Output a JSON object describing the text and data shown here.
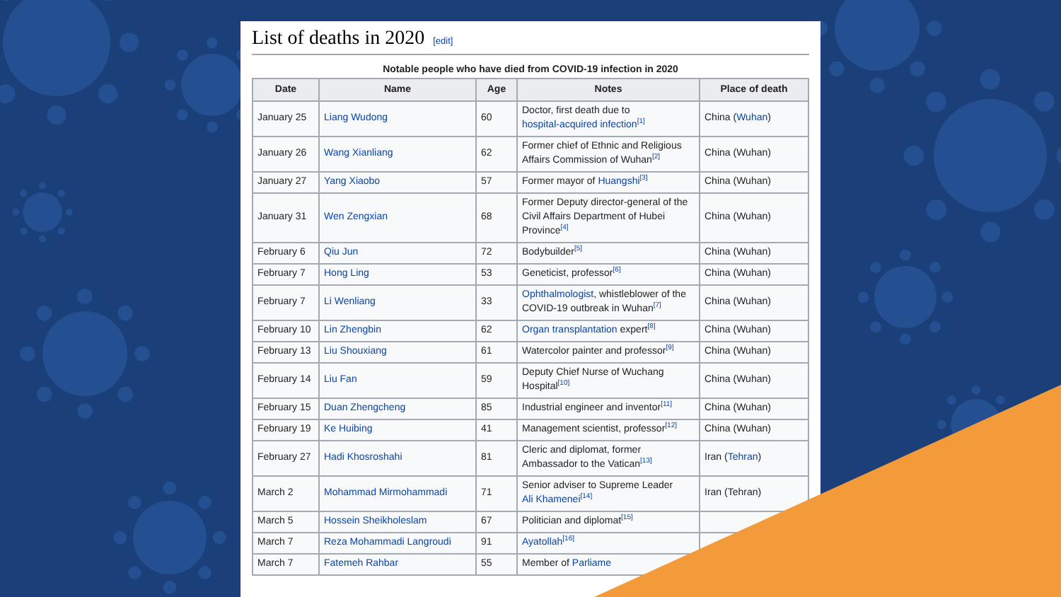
{
  "section": {
    "title": "List of deaths in 2020",
    "edit_link": "[edit]"
  },
  "table": {
    "caption": "Notable people who have died from COVID-19 infection in 2020",
    "columns": [
      "Date",
      "Name",
      "Age",
      "Notes",
      "Place of death"
    ],
    "rows": [
      {
        "date": "January 25",
        "name": "Liang Wudong",
        "age": "60",
        "notes": [
          {
            "kind": "text",
            "text": "Doctor, first death due to "
          },
          {
            "kind": "link",
            "text": "hospital-acquired infection"
          },
          {
            "kind": "ref",
            "text": "[1]"
          }
        ],
        "place": [
          {
            "kind": "text",
            "text": "China ("
          },
          {
            "kind": "link",
            "text": "Wuhan"
          },
          {
            "kind": "text",
            "text": ")"
          }
        ]
      },
      {
        "date": "January 26",
        "name": "Wang Xianliang",
        "age": "62",
        "notes": [
          {
            "kind": "text",
            "text": "Former chief of Ethnic and Religious Affairs Commission of Wuhan"
          },
          {
            "kind": "ref",
            "text": "[2]"
          }
        ],
        "place": [
          {
            "kind": "text",
            "text": "China (Wuhan)"
          }
        ]
      },
      {
        "date": "January 27",
        "name": "Yang Xiaobo",
        "age": "57",
        "notes": [
          {
            "kind": "text",
            "text": "Former mayor of "
          },
          {
            "kind": "link",
            "text": "Huangshi"
          },
          {
            "kind": "ref",
            "text": "[3]"
          }
        ],
        "place": [
          {
            "kind": "text",
            "text": "China (Wuhan)"
          }
        ]
      },
      {
        "date": "January 31",
        "name": "Wen Zengxian",
        "age": "68",
        "notes": [
          {
            "kind": "text",
            "text": "Former Deputy director-general of the Civil Affairs Department of Hubei Province"
          },
          {
            "kind": "ref",
            "text": "[4]"
          }
        ],
        "place": [
          {
            "kind": "text",
            "text": "China (Wuhan)"
          }
        ]
      },
      {
        "date": "February 6",
        "name": "Qiu Jun",
        "age": "72",
        "notes": [
          {
            "kind": "text",
            "text": "Bodybuilder"
          },
          {
            "kind": "ref",
            "text": "[5]"
          }
        ],
        "place": [
          {
            "kind": "text",
            "text": "China (Wuhan)"
          }
        ]
      },
      {
        "date": "February 7",
        "name": "Hong Ling",
        "age": "53",
        "notes": [
          {
            "kind": "text",
            "text": "Geneticist, professor"
          },
          {
            "kind": "ref",
            "text": "[6]"
          }
        ],
        "place": [
          {
            "kind": "text",
            "text": "China (Wuhan)"
          }
        ]
      },
      {
        "date": "February 7",
        "name": "Li Wenliang",
        "age": "33",
        "notes": [
          {
            "kind": "link",
            "text": "Ophthalmologist"
          },
          {
            "kind": "text",
            "text": ", whistleblower of the COVID-19 outbreak in Wuhan"
          },
          {
            "kind": "ref",
            "text": "[7]"
          }
        ],
        "place": [
          {
            "kind": "text",
            "text": "China (Wuhan)"
          }
        ]
      },
      {
        "date": "February 10",
        "name": "Lin Zhengbin",
        "age": "62",
        "notes": [
          {
            "kind": "link",
            "text": "Organ transplantation"
          },
          {
            "kind": "text",
            "text": " expert"
          },
          {
            "kind": "ref",
            "text": "[8]"
          }
        ],
        "place": [
          {
            "kind": "text",
            "text": "China (Wuhan)"
          }
        ]
      },
      {
        "date": "February 13",
        "name": "Liu Shouxiang",
        "age": "61",
        "notes": [
          {
            "kind": "text",
            "text": "Watercolor painter and professor"
          },
          {
            "kind": "ref",
            "text": "[9]"
          }
        ],
        "place": [
          {
            "kind": "text",
            "text": "China (Wuhan)"
          }
        ]
      },
      {
        "date": "February 14",
        "name": "Liu Fan",
        "age": "59",
        "notes": [
          {
            "kind": "text",
            "text": "Deputy Chief Nurse of Wuchang Hospital"
          },
          {
            "kind": "ref",
            "text": "[10]"
          }
        ],
        "place": [
          {
            "kind": "text",
            "text": "China (Wuhan)"
          }
        ]
      },
      {
        "date": "February 15",
        "name": "Duan Zhengcheng",
        "age": "85",
        "notes": [
          {
            "kind": "text",
            "text": "Industrial engineer and inventor"
          },
          {
            "kind": "ref",
            "text": "[11]"
          }
        ],
        "place": [
          {
            "kind": "text",
            "text": "China (Wuhan)"
          }
        ]
      },
      {
        "date": "February 19",
        "name": "Ke Huibing",
        "age": "41",
        "notes": [
          {
            "kind": "text",
            "text": "Management scientist, professor"
          },
          {
            "kind": "ref",
            "text": "[12]"
          }
        ],
        "place": [
          {
            "kind": "text",
            "text": "China (Wuhan)"
          }
        ]
      },
      {
        "date": "February 27",
        "name": "Hadi Khosroshahi",
        "age": "81",
        "notes": [
          {
            "kind": "text",
            "text": "Cleric and diplomat, former Ambassador to the Vatican"
          },
          {
            "kind": "ref",
            "text": "[13]"
          }
        ],
        "place": [
          {
            "kind": "text",
            "text": "Iran ("
          },
          {
            "kind": "link",
            "text": "Tehran"
          },
          {
            "kind": "text",
            "text": ")"
          }
        ]
      },
      {
        "date": "March 2",
        "name": "Mohammad Mirmohammadi",
        "age": "71",
        "notes": [
          {
            "kind": "text",
            "text": "Senior adviser to Supreme Leader "
          },
          {
            "kind": "link",
            "text": "Ali Khamenei"
          },
          {
            "kind": "ref",
            "text": "[14]"
          }
        ],
        "place": [
          {
            "kind": "text",
            "text": "Iran (Tehran)"
          }
        ]
      },
      {
        "date": "March 5",
        "name": "Hossein Sheikholeslam",
        "age": "67",
        "notes": [
          {
            "kind": "text",
            "text": "Politician and diplomat"
          },
          {
            "kind": "ref",
            "text": "[15]"
          }
        ],
        "place": []
      },
      {
        "date": "March 7",
        "name": "Reza Mohammadi Langroudi",
        "age": "91",
        "notes": [
          {
            "kind": "link",
            "text": "Ayatollah"
          },
          {
            "kind": "ref",
            "text": "[16]"
          }
        ],
        "place": []
      },
      {
        "date": "March 7",
        "name": "Fatemeh Rahbar",
        "age": "55",
        "notes": [
          {
            "kind": "text",
            "text": "Member of "
          },
          {
            "kind": "link",
            "text": "Parliame"
          }
        ],
        "place": []
      }
    ]
  }
}
